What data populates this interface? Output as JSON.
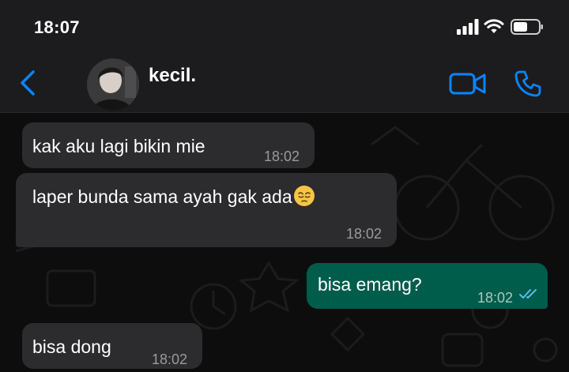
{
  "status_bar": {
    "time": "18:07",
    "icons": [
      "signal-icon",
      "wifi-icon",
      "battery-icon"
    ]
  },
  "header": {
    "contact_name": "kecil.",
    "back_icon": "chevron-left-icon",
    "video_icon": "video-camera-icon",
    "call_icon": "phone-icon",
    "accent_color": "#0a84ff"
  },
  "messages": [
    {
      "direction": "incoming",
      "text": "kak aku lagi bikin mie",
      "time": "18:02"
    },
    {
      "direction": "incoming",
      "text": "laper bunda sama ayah gak ada",
      "emoji": "pensive-face-emoji",
      "time": "18:02"
    },
    {
      "direction": "outgoing",
      "text": "bisa emang?",
      "time": "18:02",
      "status": "read-double-check"
    },
    {
      "direction": "incoming",
      "text": "bisa dong",
      "time": "18:02"
    }
  ],
  "colors": {
    "incoming_bubble": "#2c2c2e",
    "outgoing_bubble": "#005c4b",
    "read_ticks": "#53bdeb",
    "header_bg": "#1c1c1e"
  }
}
